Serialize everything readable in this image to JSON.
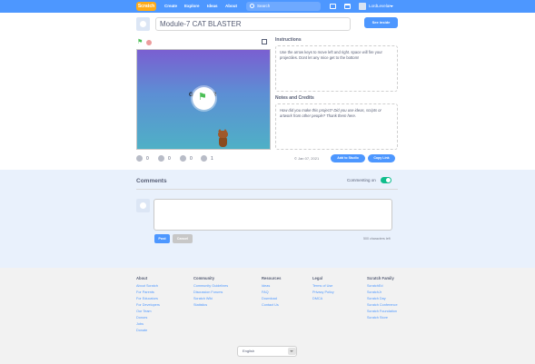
{
  "nav": {
    "logo": "Scratch",
    "links": [
      "Create",
      "Explore",
      "Ideas",
      "About"
    ],
    "search_placeholder": "Search",
    "username": "LordLevelar"
  },
  "project": {
    "title": "Module-7 CAT BLASTER",
    "see_inside": "See inside",
    "stage_title_left": "G",
    "stage_title_right": "R"
  },
  "stats": {
    "loves": "0",
    "favorites": "0",
    "remixes": "0",
    "views": "1",
    "date": "Jan 07, 2021",
    "add_to_studio": "Add to Studio",
    "copy_link": "Copy Link"
  },
  "instructions": {
    "label": "Instructions",
    "text": "Use the arrow keys to move left and right. space will fire your projectiles. Dont let any mice get to the bottom!"
  },
  "notes": {
    "label": "Notes and Credits",
    "placeholder": "How did you make this project? Did you use ideas, scripts or artwork from other people? Thank them here."
  },
  "comments": {
    "title": "Comments",
    "commenting": "Commenting on",
    "post": "Post",
    "cancel": "Cancel",
    "chars_left": "500 characters left"
  },
  "footer": {
    "columns": [
      {
        "head": "About",
        "links": [
          "About Scratch",
          "For Parents",
          "For Educators",
          "For Developers",
          "Our Team",
          "Donors",
          "Jobs",
          "Donate"
        ]
      },
      {
        "head": "Community",
        "links": [
          "Community Guidelines",
          "Discussion Forums",
          "Scratch Wiki",
          "Statistics"
        ]
      },
      {
        "head": "Resources",
        "links": [
          "Ideas",
          "FAQ",
          "Download",
          "Contact Us"
        ]
      },
      {
        "head": "Legal",
        "links": [
          "Terms of Use",
          "Privacy Policy",
          "DMCA"
        ]
      },
      {
        "head": "Scratch Family",
        "links": [
          "ScratchEd",
          "ScratchJr",
          "Scratch Day",
          "Scratch Conference",
          "Scratch Foundation",
          "Scratch Store"
        ]
      }
    ],
    "language": "English"
  },
  "colors": {
    "brand_blue": "#4d97ff",
    "logo_orange": "#ffab19",
    "toggle_green": "#0fbd8c"
  }
}
